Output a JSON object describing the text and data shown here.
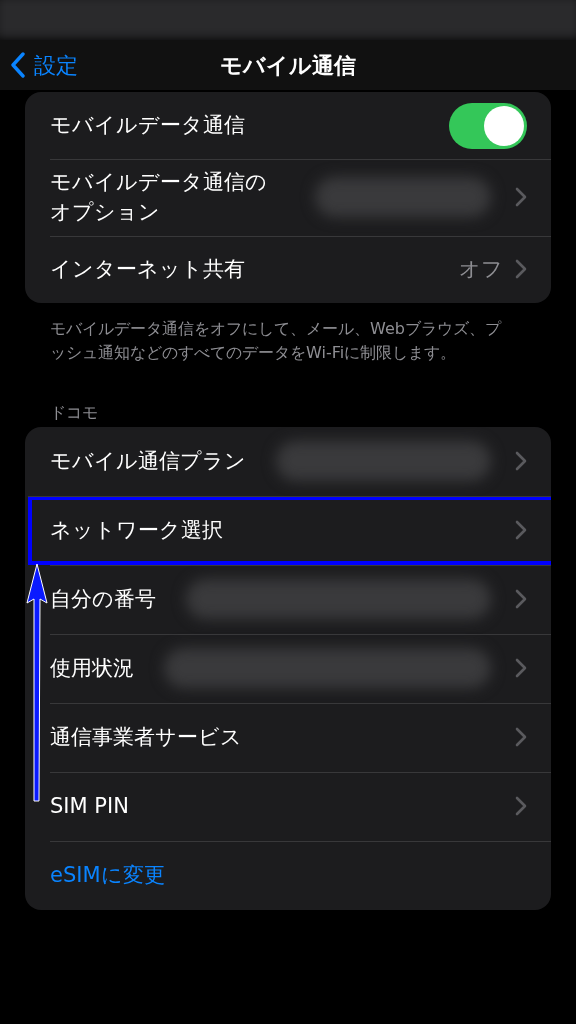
{
  "nav": {
    "back": "設定",
    "title": "モバイル通信"
  },
  "group1": [
    {
      "kind": "toggle",
      "label": "モバイルデータ通信",
      "on": true
    },
    {
      "kind": "link",
      "label": "モバイルデータ通信のオプション",
      "blurred": true
    },
    {
      "kind": "link",
      "label": "インターネット共有",
      "value": "オフ"
    }
  ],
  "group1_footer": "モバイルデータ通信をオフにして、メール、Webブラウズ、プッシュ通知などのすべてのデータをWi-Fiに制限します。",
  "group2_header": "ドコモ",
  "group2": [
    {
      "kind": "link",
      "label": "モバイル通信プラン",
      "highlighted": false,
      "blurred": true
    },
    {
      "kind": "link",
      "label": "ネットワーク選択",
      "highlighted": true
    },
    {
      "kind": "link",
      "label": "自分の番号",
      "highlighted": false,
      "blurred": true
    },
    {
      "kind": "link",
      "label": "使用状況",
      "highlighted": false,
      "blurred": true
    },
    {
      "kind": "link",
      "label": "通信事業者サービス",
      "highlighted": false
    },
    {
      "kind": "link",
      "label": "SIM PIN",
      "highlighted": false
    },
    {
      "kind": "action",
      "label": "eSIMに変更",
      "highlighted": false
    }
  ]
}
